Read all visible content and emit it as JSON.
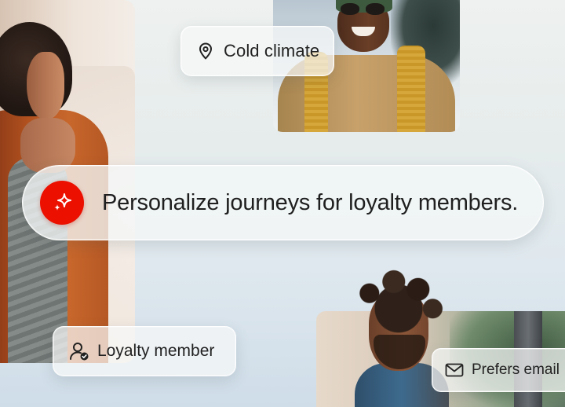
{
  "tags": {
    "location": {
      "label": "Cold climate",
      "icon": "location-pin-icon"
    },
    "membership": {
      "label": "Loyalty member",
      "icon": "user-check-icon"
    },
    "contact": {
      "label": "Prefers email",
      "icon": "mail-icon"
    }
  },
  "prompt": {
    "text": "Personalize journeys for loyalty members.",
    "icon": "sparkle-icon",
    "accent_color": "#EB1000"
  },
  "photos": [
    {
      "subject": "woman in orange jacket"
    },
    {
      "subject": "man in beanie and scarf"
    },
    {
      "subject": "man with curly hair"
    }
  ]
}
